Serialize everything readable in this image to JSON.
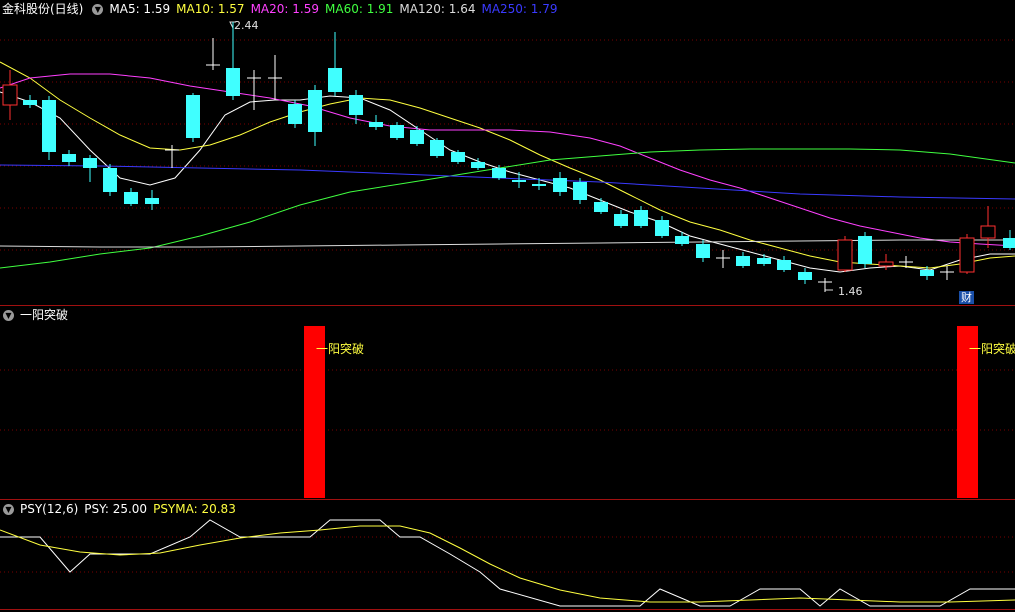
{
  "main": {
    "title": "金科股份(日线)",
    "ma": [
      {
        "label": "MA5: 1.59",
        "color": "#ffffff"
      },
      {
        "label": "MA10: 1.57",
        "color": "#ffff40"
      },
      {
        "label": "MA20: 1.59",
        "color": "#ff40ff"
      },
      {
        "label": "MA60: 1.91",
        "color": "#40ff40"
      },
      {
        "label": "MA120: 1.64",
        "color": "#dcdcdc"
      },
      {
        "label": "MA250: 1.79",
        "color": "#3a3aff"
      }
    ],
    "high_label": "2.44",
    "low_label": "1.46",
    "badge": "财"
  },
  "indicator1": {
    "title": "一阳突破",
    "signal_text": "一阳突破",
    "color": "#ff0000"
  },
  "indicator2": {
    "title": "PSY(12,6)",
    "psy": "PSY: 25.00",
    "psyma": "PSYMA: 20.83",
    "psy_color": "#ffffff",
    "psyma_color": "#ffff40"
  },
  "colors": {
    "up": "#ff3030",
    "down": "#40ffff",
    "grid": "#6a0000"
  }
}
